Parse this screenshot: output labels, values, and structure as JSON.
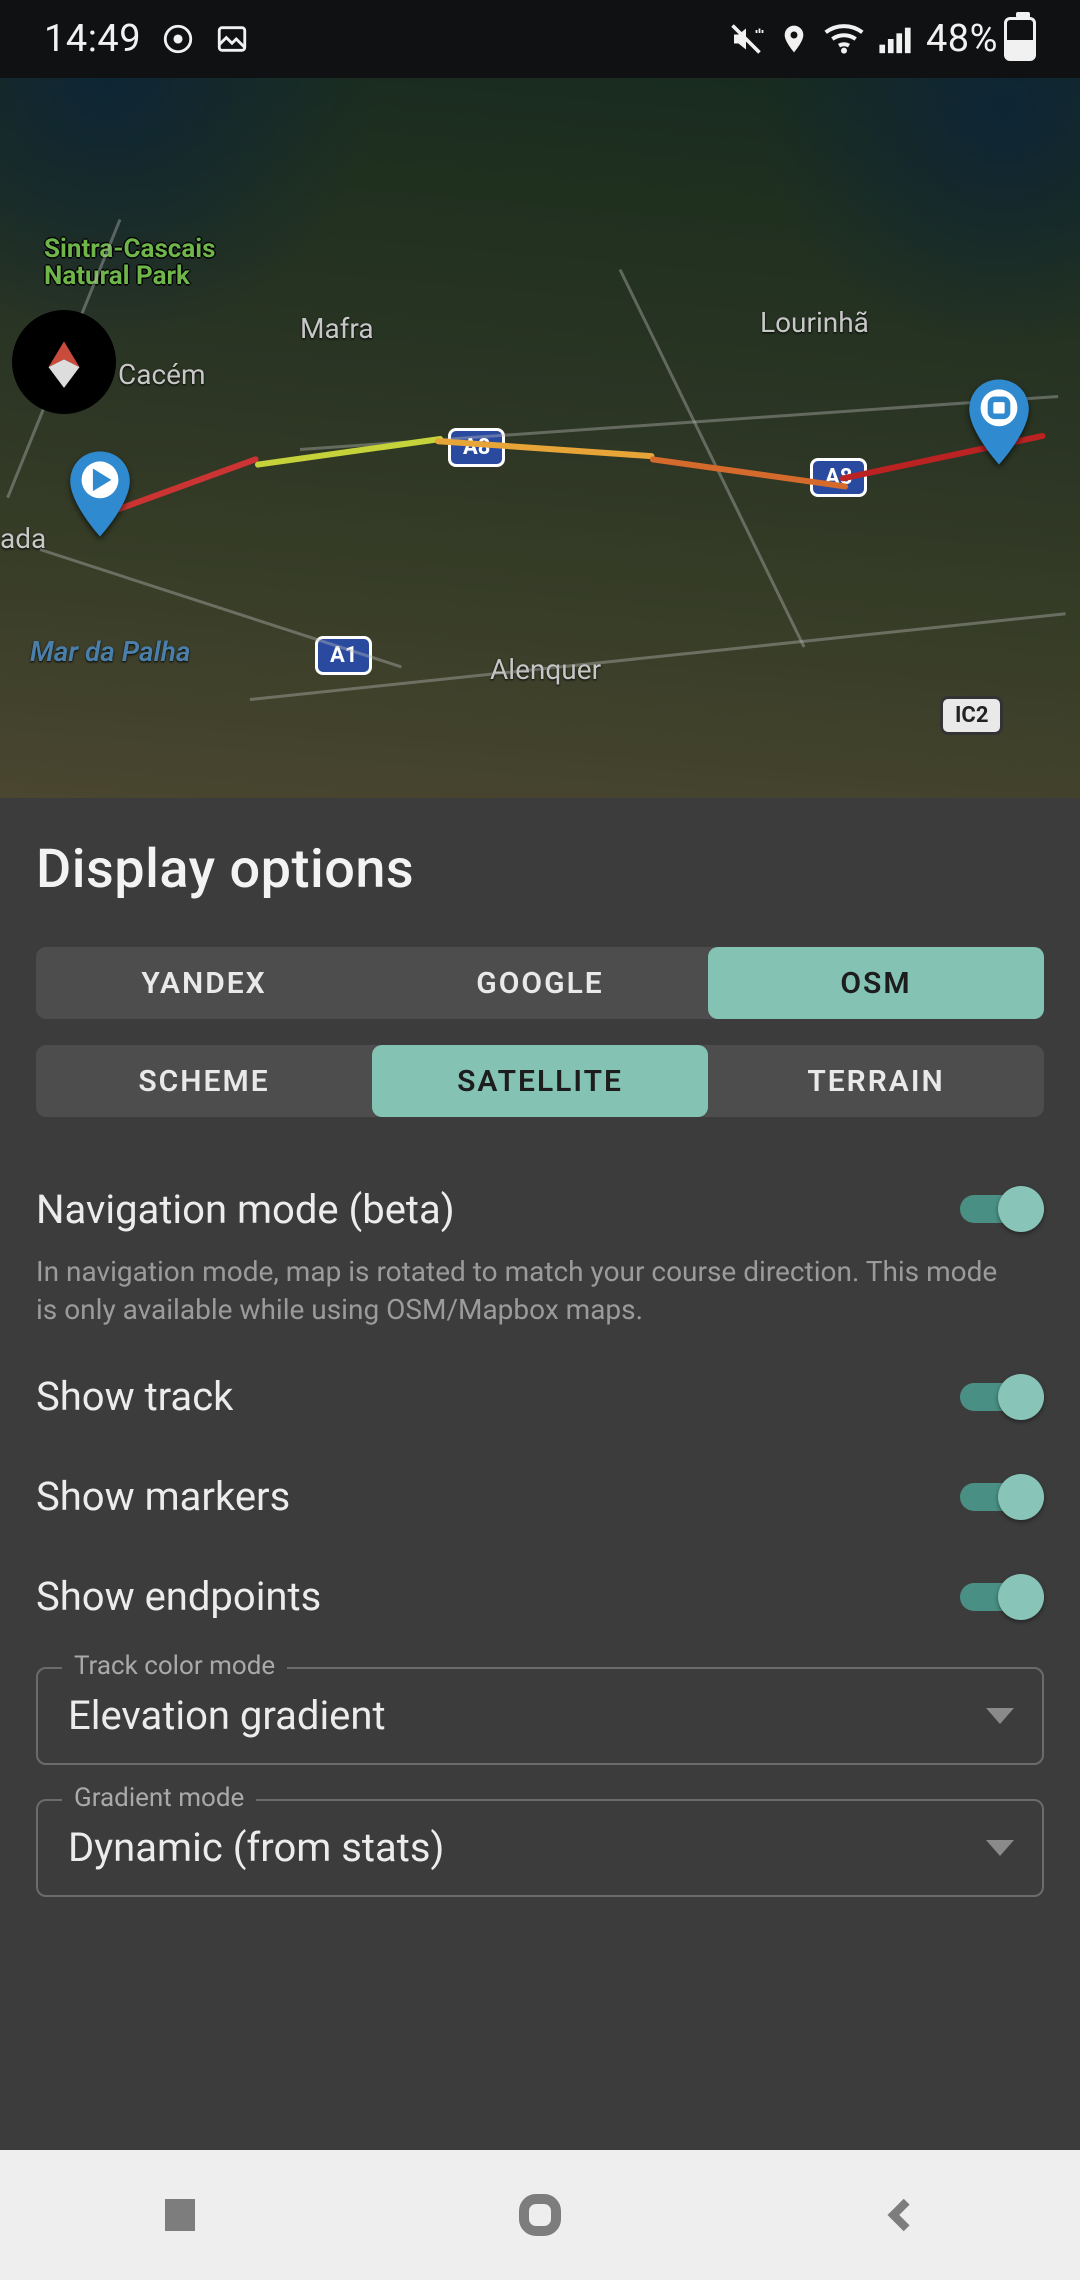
{
  "status": {
    "time": "14:49",
    "battery_pct": "48%",
    "icons": [
      "record-icon",
      "image-icon",
      "vibrate-mute-icon",
      "location-icon",
      "wifi-icon",
      "signal-icon"
    ]
  },
  "map": {
    "labels": {
      "park": "Sintra-Cascais\nNatural Park",
      "mafra": "Mafra",
      "cacem": "Cacém",
      "lour": "Lourinhã",
      "alenquer": "Alenquer",
      "sea": "Mar da Palha",
      "ada": "ada"
    },
    "shields": {
      "a8a": "A8",
      "a8b": "A8",
      "a1": "A1",
      "ic2": "IC2"
    }
  },
  "sheet": {
    "title": "Display options",
    "providers": [
      "YANDEX",
      "GOOGLE",
      "OSM"
    ],
    "provider_selected": 2,
    "map_types": [
      "SCHEME",
      "SATELLITE",
      "TERRAIN"
    ],
    "map_type_selected": 1,
    "nav_mode": {
      "label": "Navigation mode (beta)",
      "desc": "In navigation mode, map is rotated to match your course direction. This mode is only available while using OSM/Mapbox maps.",
      "on": true
    },
    "show_track": {
      "label": "Show track",
      "on": true
    },
    "show_markers": {
      "label": "Show markers",
      "on": true
    },
    "show_endpoints": {
      "label": "Show endpoints",
      "on": true
    },
    "track_color_mode": {
      "legend": "Track color mode",
      "value": "Elevation gradient"
    },
    "gradient_mode": {
      "legend": "Gradient mode",
      "value": "Dynamic (from stats)"
    }
  }
}
